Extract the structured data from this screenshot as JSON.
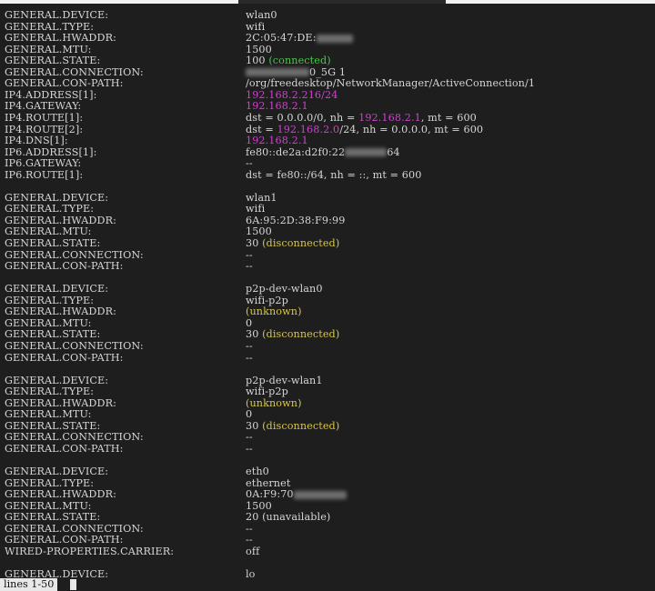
{
  "terminal": {
    "status_line": "lines 1-50",
    "colors": {
      "background": "#1e1e1e",
      "text": "#d6d6d6",
      "ip": "#d040d0",
      "connected": "#49c749",
      "disconnected": "#d6c64a"
    },
    "blocks": [
      {
        "rows": [
          {
            "field": "GENERAL.DEVICE:",
            "value": [
              {
                "t": "wlan0"
              }
            ]
          },
          {
            "field": "GENERAL.TYPE:",
            "value": [
              {
                "t": "wifi"
              }
            ]
          },
          {
            "field": "GENERAL.HWADDR:",
            "value": [
              {
                "t": "2C:05:47:DE:"
              },
              {
                "blur": 40
              }
            ]
          },
          {
            "field": "GENERAL.MTU:",
            "value": [
              {
                "t": "1500"
              }
            ]
          },
          {
            "field": "GENERAL.STATE:",
            "value": [
              {
                "t": "100 "
              },
              {
                "t": "(connected)",
                "c": "ok"
              }
            ]
          },
          {
            "field": "GENERAL.CONNECTION:",
            "value": [
              {
                "blur": 70
              },
              {
                "t": "0_5G 1"
              }
            ]
          },
          {
            "field": "GENERAL.CON-PATH:",
            "value": [
              {
                "t": "/org/freedesktop/NetworkManager/ActiveConnection/1"
              }
            ]
          },
          {
            "field": "IP4.ADDRESS[1]:",
            "value": [
              {
                "t": "192.168.2.216/24",
                "c": "ip"
              }
            ]
          },
          {
            "field": "IP4.GATEWAY:",
            "value": [
              {
                "t": "192.168.2.1",
                "c": "ip"
              }
            ]
          },
          {
            "field": "IP4.ROUTE[1]:",
            "value": [
              {
                "t": "dst = 0.0.0.0/0, nh = "
              },
              {
                "t": "192.168.2.1",
                "c": "ip"
              },
              {
                "t": ", mt = 600"
              }
            ]
          },
          {
            "field": "IP4.ROUTE[2]:",
            "value": [
              {
                "t": "dst = "
              },
              {
                "t": "192.168.2.0",
                "c": "ip"
              },
              {
                "t": "/24, nh = 0.0.0.0, mt = 600"
              }
            ]
          },
          {
            "field": "IP4.DNS[1]:",
            "value": [
              {
                "t": "192.168.2.1",
                "c": "ip"
              }
            ]
          },
          {
            "field": "IP6.ADDRESS[1]:",
            "value": [
              {
                "t": "fe80::de2a:d2f0:22"
              },
              {
                "blur": 46
              },
              {
                "t": "64"
              }
            ]
          },
          {
            "field": "IP6.GATEWAY:",
            "value": [
              {
                "t": "--"
              }
            ]
          },
          {
            "field": "IP6.ROUTE[1]:",
            "value": [
              {
                "t": "dst = fe80::/64, nh = ::, mt = 600"
              }
            ]
          }
        ]
      },
      {
        "rows": [
          {
            "field": "GENERAL.DEVICE:",
            "value": [
              {
                "t": "wlan1"
              }
            ]
          },
          {
            "field": "GENERAL.TYPE:",
            "value": [
              {
                "t": "wifi"
              }
            ]
          },
          {
            "field": "GENERAL.HWADDR:",
            "value": [
              {
                "t": "6A:95:2D:38:F9:99"
              }
            ]
          },
          {
            "field": "GENERAL.MTU:",
            "value": [
              {
                "t": "1500"
              }
            ]
          },
          {
            "field": "GENERAL.STATE:",
            "value": [
              {
                "t": "30 "
              },
              {
                "t": "(disconnected)",
                "c": "warn"
              }
            ]
          },
          {
            "field": "GENERAL.CONNECTION:",
            "value": [
              {
                "t": "--"
              }
            ]
          },
          {
            "field": "GENERAL.CON-PATH:",
            "value": [
              {
                "t": "--"
              }
            ]
          }
        ]
      },
      {
        "rows": [
          {
            "field": "GENERAL.DEVICE:",
            "value": [
              {
                "t": "p2p-dev-wlan0"
              }
            ]
          },
          {
            "field": "GENERAL.TYPE:",
            "value": [
              {
                "t": "wifi-p2p"
              }
            ]
          },
          {
            "field": "GENERAL.HWADDR:",
            "value": [
              {
                "t": "(unknown)",
                "c": "warn"
              }
            ]
          },
          {
            "field": "GENERAL.MTU:",
            "value": [
              {
                "t": "0"
              }
            ]
          },
          {
            "field": "GENERAL.STATE:",
            "value": [
              {
                "t": "30 "
              },
              {
                "t": "(disconnected)",
                "c": "warn"
              }
            ]
          },
          {
            "field": "GENERAL.CONNECTION:",
            "value": [
              {
                "t": "--"
              }
            ]
          },
          {
            "field": "GENERAL.CON-PATH:",
            "value": [
              {
                "t": "--"
              }
            ]
          }
        ]
      },
      {
        "rows": [
          {
            "field": "GENERAL.DEVICE:",
            "value": [
              {
                "t": "p2p-dev-wlan1"
              }
            ]
          },
          {
            "field": "GENERAL.TYPE:",
            "value": [
              {
                "t": "wifi-p2p"
              }
            ]
          },
          {
            "field": "GENERAL.HWADDR:",
            "value": [
              {
                "t": "(unknown)",
                "c": "warn"
              }
            ]
          },
          {
            "field": "GENERAL.MTU:",
            "value": [
              {
                "t": "0"
              }
            ]
          },
          {
            "field": "GENERAL.STATE:",
            "value": [
              {
                "t": "30 "
              },
              {
                "t": "(disconnected)",
                "c": "warn"
              }
            ]
          },
          {
            "field": "GENERAL.CONNECTION:",
            "value": [
              {
                "t": "--"
              }
            ]
          },
          {
            "field": "GENERAL.CON-PATH:",
            "value": [
              {
                "t": "--"
              }
            ]
          }
        ]
      },
      {
        "rows": [
          {
            "field": "GENERAL.DEVICE:",
            "value": [
              {
                "t": "eth0"
              }
            ]
          },
          {
            "field": "GENERAL.TYPE:",
            "value": [
              {
                "t": "ethernet"
              }
            ]
          },
          {
            "field": "GENERAL.HWADDR:",
            "value": [
              {
                "t": "0A:F9:70"
              },
              {
                "blur": 58
              }
            ]
          },
          {
            "field": "GENERAL.MTU:",
            "value": [
              {
                "t": "1500"
              }
            ]
          },
          {
            "field": "GENERAL.STATE:",
            "value": [
              {
                "t": "20 (unavailable)"
              }
            ]
          },
          {
            "field": "GENERAL.CONNECTION:",
            "value": [
              {
                "t": "--"
              }
            ]
          },
          {
            "field": "GENERAL.CON-PATH:",
            "value": [
              {
                "t": "--"
              }
            ]
          },
          {
            "field": "WIRED-PROPERTIES.CARRIER:",
            "value": [
              {
                "t": "off"
              }
            ]
          }
        ]
      },
      {
        "rows": [
          {
            "field": "GENERAL.DEVICE:",
            "value": [
              {
                "t": "lo"
              }
            ]
          }
        ]
      }
    ]
  }
}
